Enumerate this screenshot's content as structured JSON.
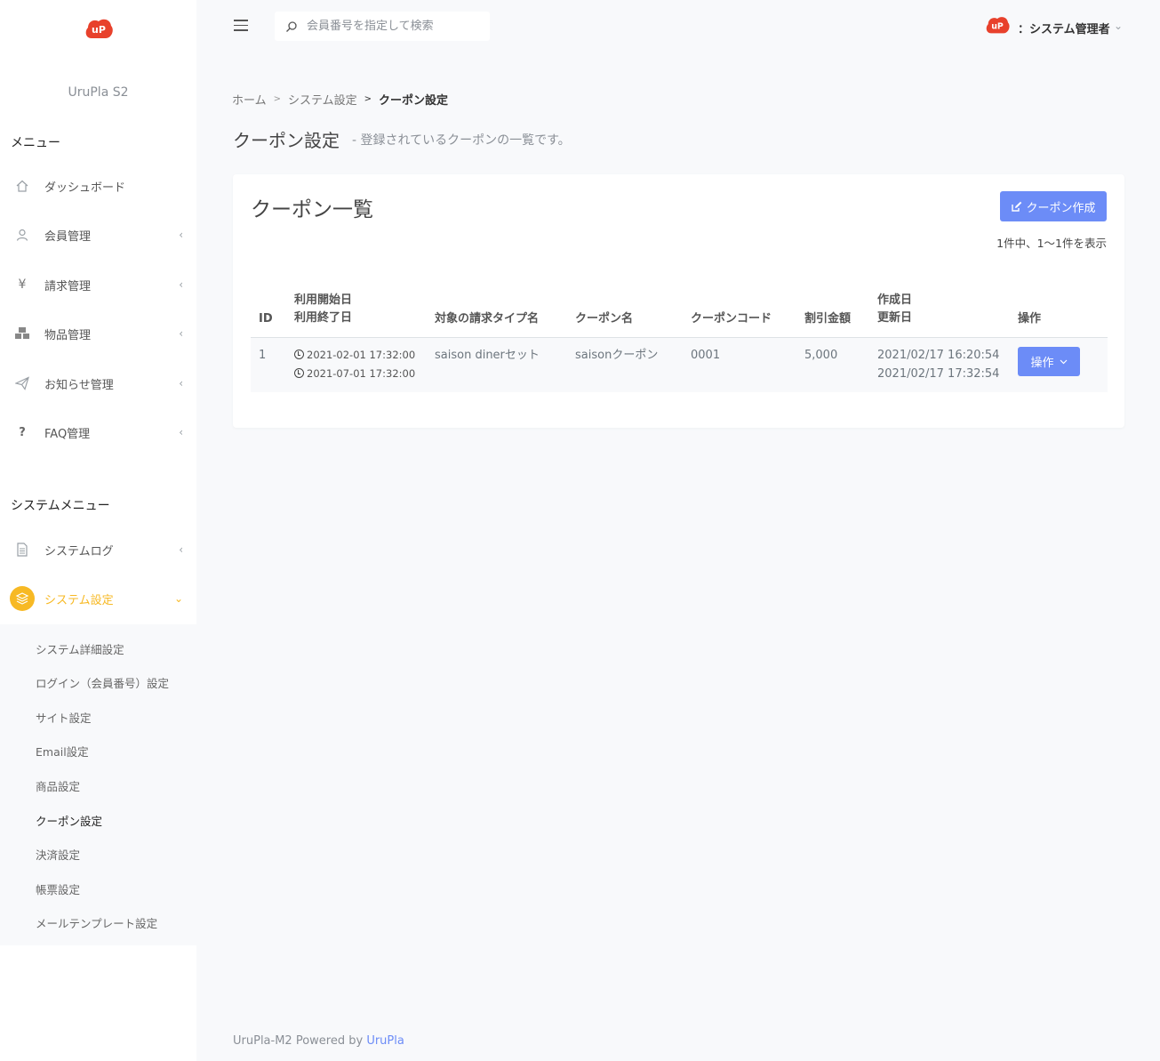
{
  "brand": {
    "name": "UruPla S2"
  },
  "colors": {
    "accent": "#f7b924",
    "primary": "#6c8cf7",
    "logo": "#e8412c"
  },
  "sidebar": {
    "menu_heading": "メニュー",
    "items": [
      {
        "label": "ダッシュボード",
        "icon": "home-icon"
      },
      {
        "label": "会員管理",
        "icon": "user-icon"
      },
      {
        "label": "請求管理",
        "icon": "yen-icon"
      },
      {
        "label": "物品管理",
        "icon": "boxes-icon"
      },
      {
        "label": "お知らせ管理",
        "icon": "paper-plane-icon"
      },
      {
        "label": "FAQ管理",
        "icon": "question-icon"
      }
    ],
    "system_heading": "システムメニュー",
    "system_items": [
      {
        "label": "システムログ",
        "icon": "document-icon"
      },
      {
        "label": "システム設定",
        "icon": "layers-icon"
      }
    ],
    "submenu": [
      "システム詳細設定",
      "ログイン（会員番号）設定",
      "サイト設定",
      "Email設定",
      "商品設定",
      "クーポン設定",
      "決済設定",
      "帳票設定",
      "メールテンプレート設定"
    ]
  },
  "header": {
    "search_placeholder": "会員番号を指定して検索",
    "user": "：システム管理者"
  },
  "breadcrumb": {
    "home": "ホーム",
    "section": "システム設定",
    "current": "クーポン設定"
  },
  "page": {
    "title": "クーポン設定",
    "subtitle": "- 登録されているクーポンの一覧です。"
  },
  "card": {
    "title": "クーポン一覧",
    "create_label": "クーポン作成",
    "count": "1件中、1〜1件を表示"
  },
  "table": {
    "headers": {
      "id": "ID",
      "start": "利用開始日",
      "end": "利用終了日",
      "type": "対象の請求タイプ名",
      "name": "クーポン名",
      "code": "クーポンコード",
      "amount": "割引金額",
      "created": "作成日",
      "updated": "更新日",
      "ops": "操作"
    },
    "rows": [
      {
        "id": "1",
        "start": "2021-02-01 17:32:00",
        "end": "2021-07-01 17:32:00",
        "type": "saison dinerセット",
        "name": "saisonクーポン",
        "code": "0001",
        "amount": "5,000",
        "created": "2021/02/17 16:20:54",
        "updated": "2021/02/17 17:32:54",
        "op_label": "操作"
      }
    ]
  },
  "footer": {
    "text": "UruPla-M2 Powered by ",
    "link": "UruPla"
  }
}
